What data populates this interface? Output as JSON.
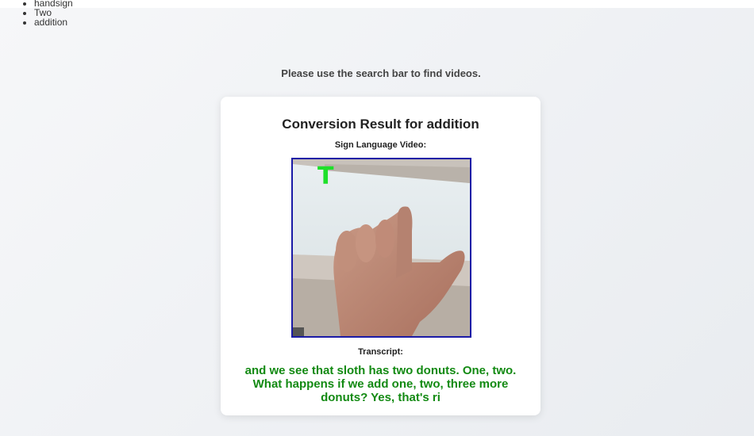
{
  "recent_searches": {
    "items": [
      "handsign",
      "Two",
      "addition"
    ]
  },
  "search_hint": "Please use the search bar to find videos.",
  "result_card": {
    "title": "Conversion Result for addition",
    "video_label": "Sign Language Video:",
    "video_overlay_letter": "T",
    "transcript_label": "Transcript:",
    "transcript_text": "and we see that sloth has two donuts. One, two. What happens if we add one, two, three more donuts? Yes, that's ri"
  },
  "colors": {
    "video_border": "#1a1aa6",
    "overlay_letter": "#1ee02a",
    "transcript_text": "#138a13"
  }
}
